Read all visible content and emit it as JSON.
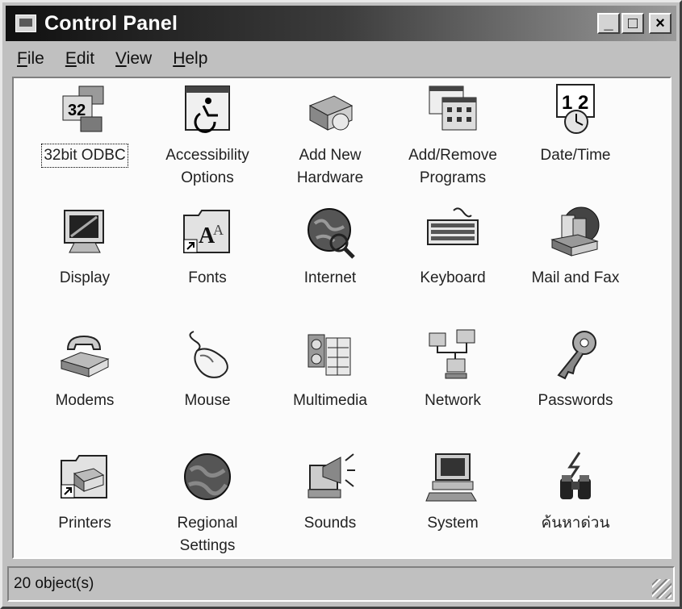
{
  "window": {
    "title": "Control Panel",
    "controls": {
      "minimize": "_",
      "maximize": "□",
      "close": "×"
    }
  },
  "menu": [
    {
      "label": "File",
      "accel": "F",
      "rest": "ile"
    },
    {
      "label": "Edit",
      "accel": "E",
      "rest": "dit"
    },
    {
      "label": "View",
      "accel": "V",
      "rest": "iew"
    },
    {
      "label": "Help",
      "accel": "H",
      "rest": "elp"
    }
  ],
  "items": [
    {
      "label": "32bit ODBC",
      "icon": "odbc-icon",
      "selected": true
    },
    {
      "label": "Accessibility Options",
      "icon": "accessibility-icon"
    },
    {
      "label": "Add New Hardware",
      "icon": "add-hardware-icon"
    },
    {
      "label": "Add/Remove Programs",
      "icon": "add-remove-programs-icon"
    },
    {
      "label": "Date/Time",
      "icon": "date-time-icon"
    },
    {
      "label": "Display",
      "icon": "display-icon"
    },
    {
      "label": "Fonts",
      "icon": "fonts-icon"
    },
    {
      "label": "Internet",
      "icon": "internet-icon"
    },
    {
      "label": "Keyboard",
      "icon": "keyboard-icon"
    },
    {
      "label": "Mail and Fax",
      "icon": "mail-fax-icon"
    },
    {
      "label": "Modems",
      "icon": "modem-icon"
    },
    {
      "label": "Mouse",
      "icon": "mouse-icon"
    },
    {
      "label": "Multimedia",
      "icon": "multimedia-icon"
    },
    {
      "label": "Network",
      "icon": "network-icon"
    },
    {
      "label": "Passwords",
      "icon": "passwords-icon"
    },
    {
      "label": "Printers",
      "icon": "printers-icon"
    },
    {
      "label": "Regional Settings",
      "icon": "regional-settings-icon"
    },
    {
      "label": "Sounds",
      "icon": "sounds-icon"
    },
    {
      "label": "System",
      "icon": "system-icon"
    },
    {
      "label": "ค้นหาด่วน",
      "icon": "quick-find-icon"
    }
  ],
  "status": {
    "text": "20 object(s)"
  }
}
